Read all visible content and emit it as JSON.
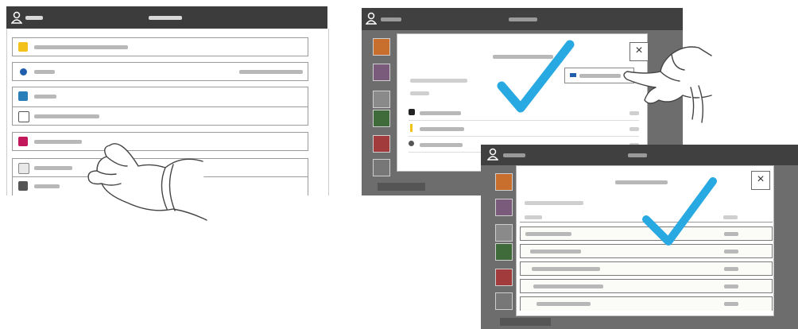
{
  "colors": {
    "header_dark": "#3c3c3c",
    "check_blue": "#29a9e1",
    "panel_grey": "#6d6d6d",
    "icon_yellow": "#f2c21b",
    "icon_blue": "#1f5fae",
    "icon_teal": "#2a7fb8",
    "icon_magenta": "#c2185b"
  },
  "left_screen": {
    "icons": [
      "user-icon"
    ],
    "row_icons": [
      "copy-app-icon",
      "blue-dot-icon",
      "app-icon",
      "number-icon",
      "app-icon",
      "app-icon",
      "app-icon"
    ]
  },
  "right_top": {
    "close_label": "×",
    "icons": [
      "checkmark-icon",
      "pointing-hand-icon",
      "close-icon"
    ]
  },
  "right_bottom": {
    "close_label": "×",
    "icons": [
      "checkmark-icon",
      "close-icon"
    ]
  }
}
